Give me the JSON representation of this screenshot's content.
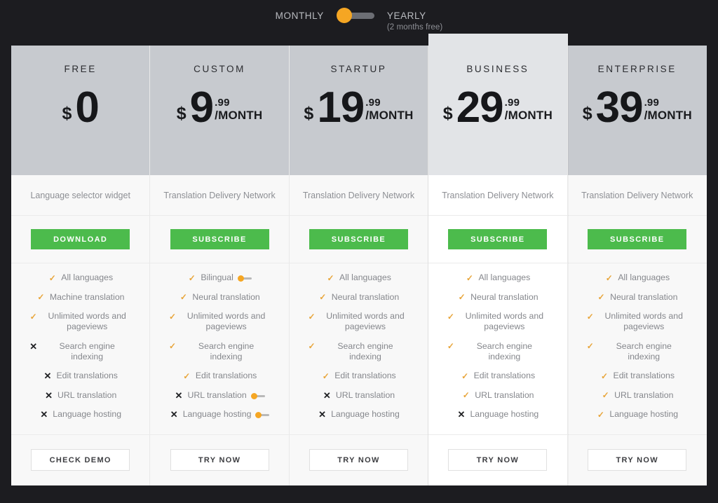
{
  "billing": {
    "monthly_label": "MONTHLY",
    "yearly_label": "YEARLY",
    "yearly_note": "(2 months free)",
    "selected": "MONTHLY",
    "knob_color": "#f5a623",
    "track_color": "#6c6e74"
  },
  "theme": {
    "page_background": "#1c1c20",
    "header_background": "#c7cacf",
    "featured_header_background": "#e2e4e7",
    "card_background": "#f8f8f8",
    "featured_card_background": "#ffffff",
    "primary_button": "#4cbb4c",
    "check_color": "#e8a53a",
    "cross_color": "#1f2023"
  },
  "plans": [
    {
      "name": "FREE",
      "currency": "$",
      "amount": "0",
      "cents": "",
      "period": "",
      "subtitle": "Language selector widget",
      "cta_label": "DOWNLOAD",
      "footer_label": "CHECK DEMO",
      "featured": false,
      "features": [
        {
          "label": "All languages",
          "state": "included",
          "badge": false
        },
        {
          "label": "Machine translation",
          "state": "included",
          "badge": false
        },
        {
          "label": "Unlimited words and pageviews",
          "state": "included",
          "badge": false
        },
        {
          "label": "Search engine indexing",
          "state": "excluded",
          "badge": false
        },
        {
          "label": "Edit translations",
          "state": "excluded",
          "badge": false
        },
        {
          "label": "URL translation",
          "state": "excluded",
          "badge": false
        },
        {
          "label": "Language hosting",
          "state": "excluded",
          "badge": false
        }
      ]
    },
    {
      "name": "CUSTOM",
      "currency": "$",
      "amount": "9",
      "cents": ".99",
      "period": "/MONTH",
      "subtitle": "Translation Delivery Network",
      "cta_label": "SUBSCRIBE",
      "footer_label": "TRY NOW",
      "featured": false,
      "features": [
        {
          "label": "Bilingual",
          "state": "included",
          "badge": true
        },
        {
          "label": "Neural translation",
          "state": "included",
          "badge": false
        },
        {
          "label": "Unlimited words and pageviews",
          "state": "included",
          "badge": false
        },
        {
          "label": "Search engine indexing",
          "state": "included",
          "badge": false
        },
        {
          "label": "Edit translations",
          "state": "included",
          "badge": false
        },
        {
          "label": "URL translation",
          "state": "excluded",
          "badge": true
        },
        {
          "label": "Language hosting",
          "state": "excluded",
          "badge": true
        }
      ]
    },
    {
      "name": "STARTUP",
      "currency": "$",
      "amount": "19",
      "cents": ".99",
      "period": "/MONTH",
      "subtitle": "Translation Delivery Network",
      "cta_label": "SUBSCRIBE",
      "footer_label": "TRY NOW",
      "featured": false,
      "features": [
        {
          "label": "All languages",
          "state": "included",
          "badge": false
        },
        {
          "label": "Neural translation",
          "state": "included",
          "badge": false
        },
        {
          "label": "Unlimited words and pageviews",
          "state": "included",
          "badge": false
        },
        {
          "label": "Search engine indexing",
          "state": "included",
          "badge": false
        },
        {
          "label": "Edit translations",
          "state": "included",
          "badge": false
        },
        {
          "label": "URL translation",
          "state": "excluded",
          "badge": false
        },
        {
          "label": "Language hosting",
          "state": "excluded",
          "badge": false
        }
      ]
    },
    {
      "name": "BUSINESS",
      "currency": "$",
      "amount": "29",
      "cents": ".99",
      "period": "/MONTH",
      "subtitle": "Translation Delivery Network",
      "cta_label": "SUBSCRIBE",
      "footer_label": "TRY NOW",
      "featured": true,
      "features": [
        {
          "label": "All languages",
          "state": "included",
          "badge": false
        },
        {
          "label": "Neural translation",
          "state": "included",
          "badge": false
        },
        {
          "label": "Unlimited words and pageviews",
          "state": "included",
          "badge": false
        },
        {
          "label": "Search engine indexing",
          "state": "included",
          "badge": false
        },
        {
          "label": "Edit translations",
          "state": "included",
          "badge": false
        },
        {
          "label": "URL translation",
          "state": "included",
          "badge": false
        },
        {
          "label": "Language hosting",
          "state": "excluded",
          "badge": false
        }
      ]
    },
    {
      "name": "ENTERPRISE",
      "currency": "$",
      "amount": "39",
      "cents": ".99",
      "period": "/MONTH",
      "subtitle": "Translation Delivery Network",
      "cta_label": "SUBSCRIBE",
      "footer_label": "TRY NOW",
      "featured": false,
      "features": [
        {
          "label": "All languages",
          "state": "included",
          "badge": false
        },
        {
          "label": "Neural translation",
          "state": "included",
          "badge": false
        },
        {
          "label": "Unlimited words and pageviews",
          "state": "included",
          "badge": false
        },
        {
          "label": "Search engine indexing",
          "state": "included",
          "badge": false
        },
        {
          "label": "Edit translations",
          "state": "included",
          "badge": false
        },
        {
          "label": "URL translation",
          "state": "included",
          "badge": false
        },
        {
          "label": "Language hosting",
          "state": "included",
          "badge": false
        }
      ]
    }
  ],
  "icons": {
    "check": "✓",
    "cross": "✕"
  }
}
